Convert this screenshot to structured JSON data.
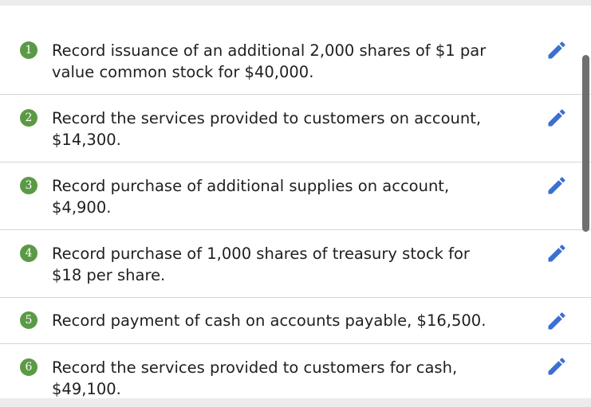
{
  "tasks": [
    {
      "number": "1",
      "text": "Record issuance of an additional 2,000 shares of $1 par value common stock for $40,000."
    },
    {
      "number": "2",
      "text": "Record the services provided to customers on account, $14,300."
    },
    {
      "number": "3",
      "text": "Record purchase of additional supplies on account, $4,900."
    },
    {
      "number": "4",
      "text": "Record purchase of 1,000 shares of treasury stock for $18 per share."
    },
    {
      "number": "5",
      "text": "Record payment of cash on accounts payable, $16,500."
    },
    {
      "number": "6",
      "text": "Record the services provided to customers for cash, $49,100."
    }
  ],
  "colors": {
    "badge": "#5b9a45",
    "edit_icon": "#3b6fd1",
    "divider": "#d6d6d6"
  },
  "icons": {
    "edit": "pencil-icon"
  }
}
